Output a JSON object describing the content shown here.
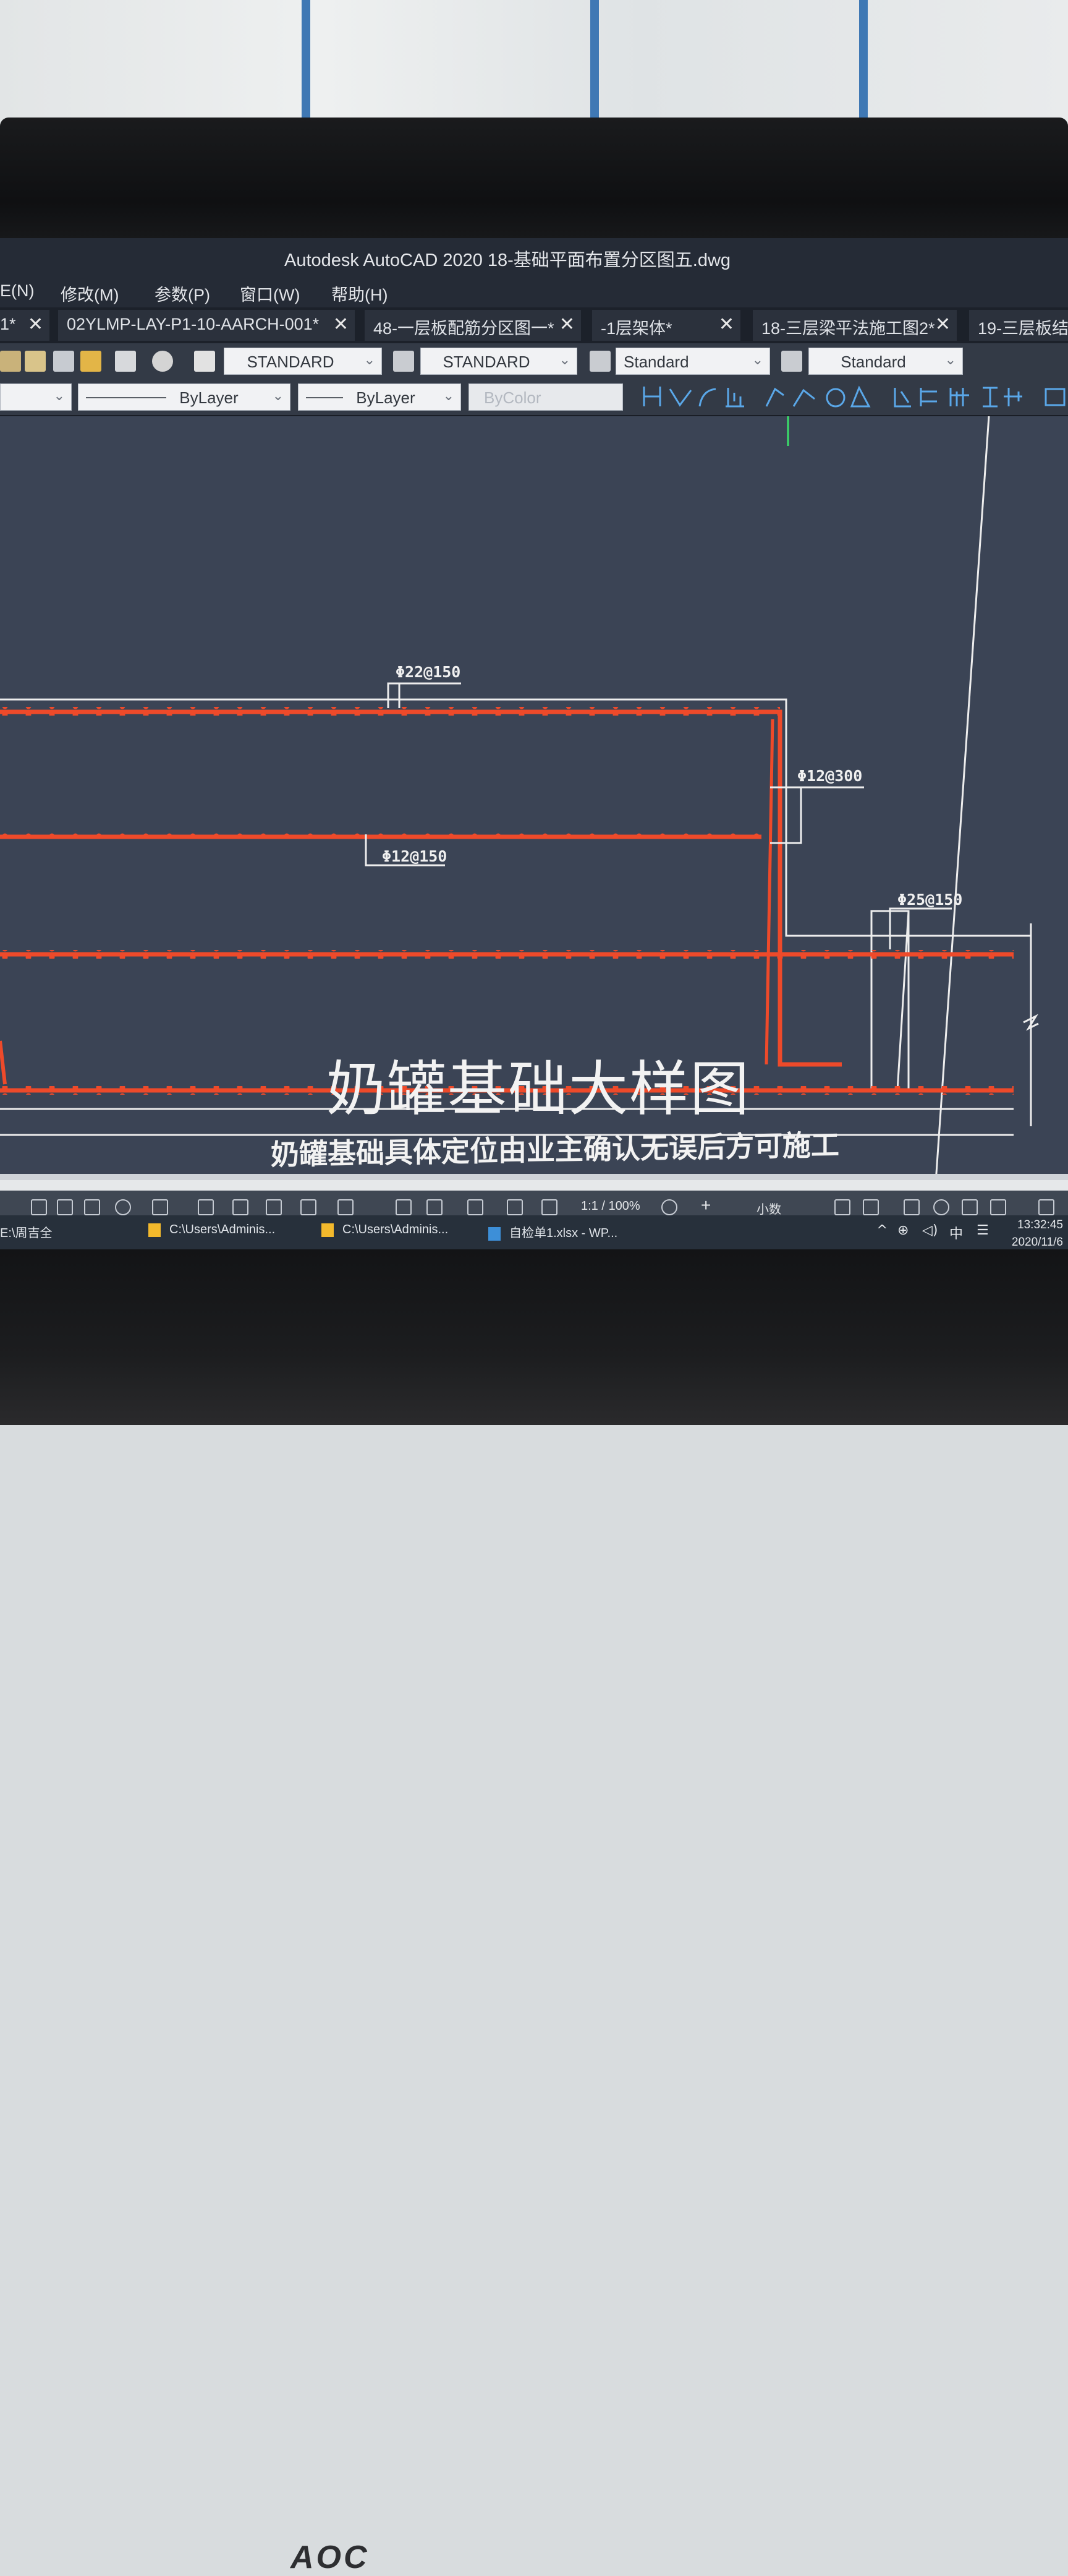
{
  "window": {
    "title": "Autodesk AutoCAD 2020    18-基础平面布置分区图五.dwg"
  },
  "menu": [
    {
      "label": "E(N)"
    },
    {
      "label": "修改(M)"
    },
    {
      "label": "参数(P)"
    },
    {
      "label": "窗口(W)"
    },
    {
      "label": "帮助(H)"
    }
  ],
  "tabs": [
    {
      "label": "1*"
    },
    {
      "label": "02YLMP-LAY-P1-10-AARCH-001*"
    },
    {
      "label": "48-一层板配筋分区图一*"
    },
    {
      "label": "-1层架体*"
    },
    {
      "label": "18-三层梁平法施工图2*"
    },
    {
      "label": "19-三层板结"
    }
  ],
  "toolbar": {
    "text_style": "STANDARD",
    "dim_style": "STANDARD",
    "table_style": "Standard",
    "multileader_style": "Standard",
    "linetype": "ByLayer",
    "lineweight": "ByLayer",
    "plot_style": "ByColor"
  },
  "drawing": {
    "labels": {
      "rebar_top": "Φ22@150",
      "rebar_right": "Φ12@300",
      "rebar_mid": "Φ12@150",
      "rebar_wall": "Φ25@150"
    },
    "title": "奶罐基础大样图",
    "note": "奶罐基础具体定位由业主确认无误后方可施工",
    "colors": {
      "rebar": "#ee4a2a",
      "outline": "#ededed",
      "underline": "#e070d8",
      "background": "#3b4455"
    }
  },
  "statusbar": {
    "scale": "1:1 / 100%",
    "units": "小数"
  },
  "taskbar": {
    "items": [
      {
        "label": "E:\\周吉全"
      },
      {
        "label": "C:\\Users\\Adminis..."
      },
      {
        "label": "C:\\Users\\Adminis..."
      },
      {
        "label": "自检单1.xlsx - WP..."
      }
    ],
    "ime": "中",
    "time": "13:32:45",
    "date": "2020/11/6"
  },
  "monitor": {
    "brand": "AOC"
  }
}
